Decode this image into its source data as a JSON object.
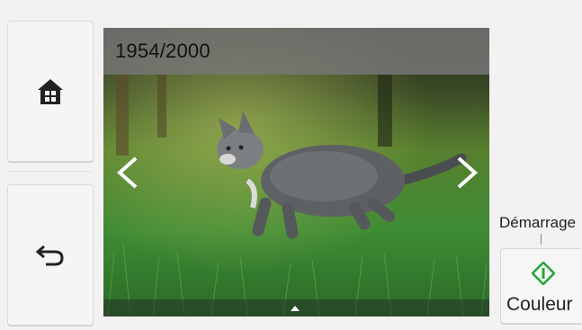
{
  "nav": {
    "home_icon": "home-icon",
    "back_icon": "back-arrow-icon"
  },
  "viewer": {
    "counter": "1954/2000",
    "photo_subject": "kitten-on-grass-photo",
    "prev_icon": "chevron-left-icon",
    "next_icon": "chevron-right-icon",
    "up_icon": "caret-up-icon"
  },
  "start": {
    "caption": "Démarrage",
    "button_label": "Couleur",
    "icon": "start-diamond-icon",
    "icon_color": "#2aa53a"
  }
}
